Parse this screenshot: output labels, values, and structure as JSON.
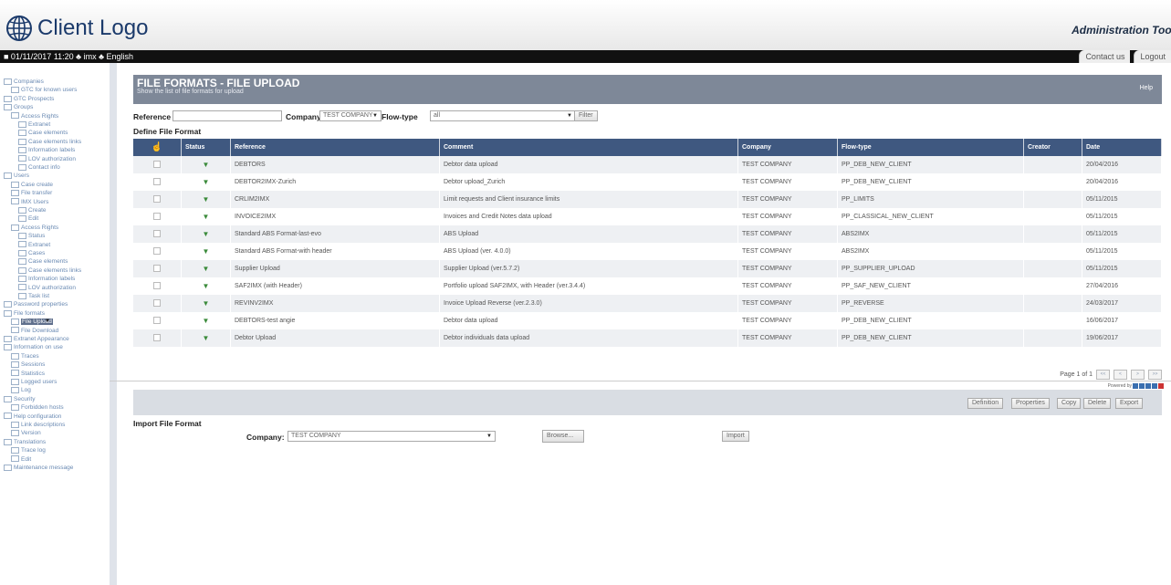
{
  "header": {
    "logo_text": "Client Logo",
    "app_title": "Administration Tool",
    "status_line": "■ 01/11/2017 11:20  ♣ imx  ♣ English",
    "contact_us": "Contact us",
    "logout": "Logout"
  },
  "sidebar": {
    "items": [
      {
        "label": "Companies",
        "level": 0
      },
      {
        "label": "GTC for known users",
        "level": 1
      },
      {
        "label": "GTC Prospects",
        "level": 0
      },
      {
        "label": "Groups",
        "level": 0
      },
      {
        "label": "Access Rights",
        "level": 1
      },
      {
        "label": "Extranet",
        "level": 2
      },
      {
        "label": "Case elements",
        "level": 2
      },
      {
        "label": "Case elements links",
        "level": 2
      },
      {
        "label": "Information labels",
        "level": 2
      },
      {
        "label": "LOV authorization",
        "level": 2
      },
      {
        "label": "Contact info",
        "level": 2
      },
      {
        "label": "Users",
        "level": 0
      },
      {
        "label": "Case create",
        "level": 1
      },
      {
        "label": "File transfer",
        "level": 1
      },
      {
        "label": "IMX Users",
        "level": 1
      },
      {
        "label": "Create",
        "level": 2
      },
      {
        "label": "Edit",
        "level": 2
      },
      {
        "label": "Access Rights",
        "level": 1
      },
      {
        "label": "Status",
        "level": 2
      },
      {
        "label": "Extranet",
        "level": 2
      },
      {
        "label": "Cases",
        "level": 2
      },
      {
        "label": "Case elements",
        "level": 2
      },
      {
        "label": "Case elements links",
        "level": 2
      },
      {
        "label": "Information labels",
        "level": 2
      },
      {
        "label": "LOV authorization",
        "level": 2
      },
      {
        "label": "Task list",
        "level": 2
      },
      {
        "label": "Password properties",
        "level": 0
      },
      {
        "label": "File formats",
        "level": 0
      },
      {
        "label": "File Upload",
        "level": 1,
        "selected": true
      },
      {
        "label": "File Download",
        "level": 1
      },
      {
        "label": "Extranet Appearance",
        "level": 0
      },
      {
        "label": "Information on use",
        "level": 0
      },
      {
        "label": "Traces",
        "level": 1
      },
      {
        "label": "Sessions",
        "level": 1
      },
      {
        "label": "Statistics",
        "level": 1
      },
      {
        "label": "Logged users",
        "level": 1
      },
      {
        "label": "Log",
        "level": 1
      },
      {
        "label": "Security",
        "level": 0
      },
      {
        "label": "Forbidden hosts",
        "level": 1
      },
      {
        "label": "Help configuration",
        "level": 0
      },
      {
        "label": "Link descriptions",
        "level": 1
      },
      {
        "label": "Version",
        "level": 1
      },
      {
        "label": "Translations",
        "level": 0
      },
      {
        "label": "Trace log",
        "level": 1
      },
      {
        "label": "Edit",
        "level": 1
      },
      {
        "label": "Maintenance message",
        "level": 0
      }
    ]
  },
  "page": {
    "title": "FILE FORMATS - FILE UPLOAD",
    "subtitle": "Show the list of file formats for upload",
    "help": "Help"
  },
  "filters": {
    "reference_label": "Reference",
    "reference_value": "",
    "company_label": "Company",
    "company_value": "TEST COMPANY",
    "flowtype_label": "Flow-type",
    "flowtype_value": "all",
    "filter_button": "Filter"
  },
  "table": {
    "section_label": "Define File Format",
    "columns": [
      "Status",
      "Reference",
      "Comment",
      "Company",
      "Flow-type",
      "Creator",
      "Date"
    ],
    "rows": [
      {
        "reference": "DEBTORS",
        "comment": "Debtor data upload",
        "company": "TEST COMPANY",
        "flowtype": "PP_DEB_NEW_CLIENT",
        "creator": "",
        "date": "20/04/2016"
      },
      {
        "reference": "DEBTOR2IMX-Zurich",
        "comment": "Debtor upload_Zurich",
        "company": "TEST COMPANY",
        "flowtype": "PP_DEB_NEW_CLIENT",
        "creator": "",
        "date": "20/04/2016"
      },
      {
        "reference": "CRLIM2IMX",
        "comment": "Limit requests and Client insurance limits",
        "company": "TEST COMPANY",
        "flowtype": "PP_LIMITS",
        "creator": "",
        "date": "05/11/2015"
      },
      {
        "reference": "INVOICE2IMX",
        "comment": "Invoices and Credit Notes data upload",
        "company": "TEST COMPANY",
        "flowtype": "PP_CLASSICAL_NEW_CLIENT",
        "creator": "",
        "date": "05/11/2015"
      },
      {
        "reference": "Standard ABS Format-last-evo",
        "comment": "ABS Upload",
        "company": "TEST COMPANY",
        "flowtype": "ABS2IMX",
        "creator": "",
        "date": "05/11/2015"
      },
      {
        "reference": "Standard ABS Format-with header",
        "comment": "ABS Upload (ver. 4.0.0)",
        "company": "TEST COMPANY",
        "flowtype": "ABS2IMX",
        "creator": "",
        "date": "05/11/2015"
      },
      {
        "reference": "Supplier Upload",
        "comment": "Supplier Upload (ver.5.7.2)",
        "company": "TEST COMPANY",
        "flowtype": "PP_SUPPLIER_UPLOAD",
        "creator": "",
        "date": "05/11/2015"
      },
      {
        "reference": "SAF2IMX (with Header)",
        "comment": "Portfolio upload SAF2IMX, with Header (ver.3.4.4)",
        "company": "TEST COMPANY",
        "flowtype": "PP_SAF_NEW_CLIENT",
        "creator": "",
        "date": "27/04/2016"
      },
      {
        "reference": "REVINV2IMX",
        "comment": "Invoice Upload Reverse (ver.2.3.0)",
        "company": "TEST COMPANY",
        "flowtype": "PP_REVERSE",
        "creator": "",
        "date": "24/03/2017"
      },
      {
        "reference": "DEBTORS-test angie",
        "comment": "Debtor data upload",
        "company": "TEST COMPANY",
        "flowtype": "PP_DEB_NEW_CLIENT",
        "creator": "",
        "date": "16/06/2017"
      },
      {
        "reference": "Debtor Upload",
        "comment": "Debtor individuals data upload",
        "company": "TEST COMPANY",
        "flowtype": "PP_DEB_NEW_CLIENT",
        "creator": "",
        "date": "19/06/2017"
      }
    ]
  },
  "pager": {
    "text": "Page 1 of 1",
    "first": "<<",
    "prev": "<",
    "next": ">",
    "last": ">>"
  },
  "actions": {
    "definition": "Definition",
    "properties": "Properties",
    "copy": "Copy",
    "delete": "Delete",
    "export": "Export"
  },
  "import": {
    "label": "Import File Format",
    "company_label": "Company:",
    "company_value": "TEST COMPANY",
    "browse": "Browse...",
    "import_button": "Import"
  },
  "footer": {
    "powered_by": "Powered by"
  }
}
